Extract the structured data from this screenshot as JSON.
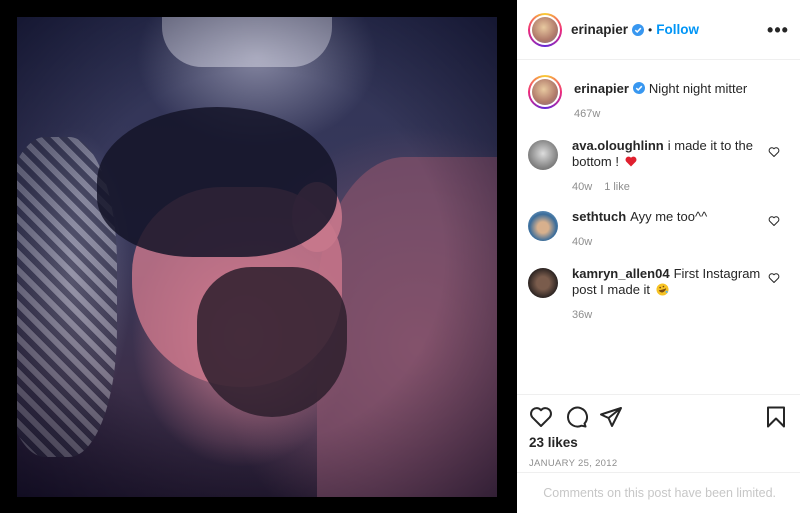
{
  "post": {
    "author": "erinapier",
    "follow_label": "Follow",
    "separator": "•",
    "more_label": "•••"
  },
  "caption": {
    "username": "erinapier",
    "text": "Night night mitter",
    "age": "467w"
  },
  "comments": [
    {
      "username": "ava.oloughlinn",
      "text": "i made it to the bottom !",
      "emoji": "red-heart",
      "age": "40w",
      "likes": "1 like"
    },
    {
      "username": "sethtuch",
      "text": "Ayy me too^^",
      "age": "40w"
    },
    {
      "username": "kamryn_allen04",
      "text": "First Instagram post I made it",
      "emoji": "rolling-laughing-face",
      "age": "36w"
    }
  ],
  "engagement": {
    "likes": "23 likes",
    "date": "JANUARY 25, 2012"
  },
  "footer": {
    "limited_text": "Comments on this post have been limited."
  },
  "colors": {
    "follow_blue": "#0095f6",
    "verified_blue": "#3897f0",
    "muted_text": "#8e8e8e"
  }
}
